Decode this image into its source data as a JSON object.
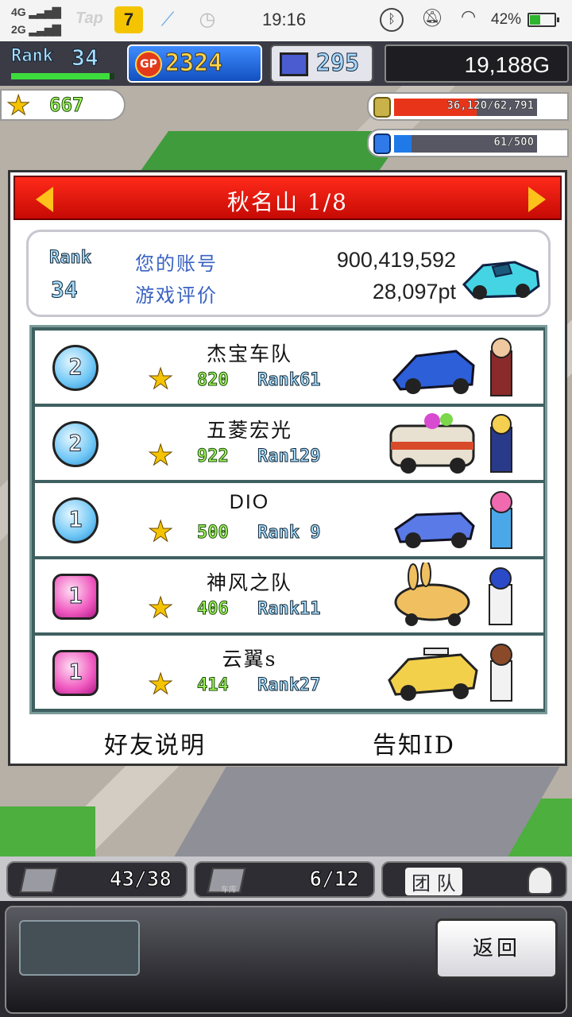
{
  "status_bar": {
    "signal_1": "4G",
    "signal_2": "2G",
    "tap_label": "Tap",
    "seven_icon": "7",
    "time": "19:16",
    "battery_pct": "42%",
    "battery_level": 0.42
  },
  "hud": {
    "rank_label": "Rank",
    "rank_value": "34",
    "rank_progress": 0.95,
    "gp_badge": "GP",
    "gp_value": "2324",
    "pc_value": "295",
    "gold_value": "19,188G",
    "stars_value": "667",
    "fuel_text": "36,120/62,791",
    "fuel_level": 0.575,
    "fuel_color": "#e8351a",
    "energy_text": "61/500",
    "energy_level": 0.122,
    "energy_color": "#1f7ae8"
  },
  "dialog": {
    "title": "秋名山 1/8",
    "my_rank_label": "Rank",
    "my_rank_value": "34",
    "account_label": "您的账号",
    "account_value": "900,419,592",
    "rating_label": "游戏评价",
    "rating_value": "28,097pt",
    "friends": [
      {
        "badge": "2",
        "badge_style": "blue",
        "name": "杰宝车队",
        "score": "820",
        "rank": "Rank61"
      },
      {
        "badge": "2",
        "badge_style": "blue",
        "name": "五菱宏光",
        "score": "922",
        "rank": "Ran129"
      },
      {
        "badge": "1",
        "badge_style": "blue",
        "name": "DIO",
        "score": "500",
        "rank": "Rank 9"
      },
      {
        "badge": "1",
        "badge_style": "pink",
        "name": "神风之队",
        "score": "406",
        "rank": "Rank11"
      },
      {
        "badge": "1",
        "badge_style": "pink",
        "name": "云翼s",
        "score": "414",
        "rank": "Rank27"
      }
    ],
    "friend_help": "好友说明",
    "notify_id": "告知ID"
  },
  "bottom": {
    "tab1_count": "43/38",
    "tab2_count": "6/12",
    "tab2_sub": "车库",
    "tab3_label": "团 队",
    "back_label": "返回"
  },
  "icons": {
    "bluetooth": "bluetooth-icon",
    "mute": "mute-icon",
    "wifi": "wifi-icon",
    "star": "star-icon"
  }
}
